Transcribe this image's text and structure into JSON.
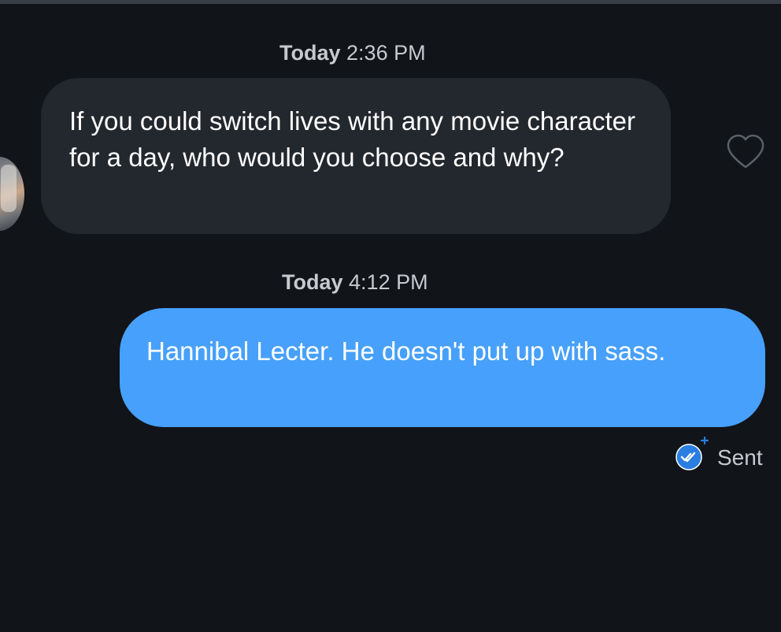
{
  "conversation": {
    "messages": [
      {
        "timestamp_day": "Today",
        "timestamp_time": "2:36 PM",
        "text": "If you could switch lives with any movie character for a day, who would you choose and why?"
      },
      {
        "timestamp_day": "Today",
        "timestamp_time": "4:12 PM",
        "text": "Hannibal Lecter. He doesn't put up with sass."
      }
    ],
    "status": "Sent"
  },
  "icons": {
    "like": "heart-outline-icon",
    "delivery": "double-check-icon"
  },
  "colors": {
    "background": "#111419",
    "received_bubble": "#23272e",
    "sent_bubble": "#47a0fb",
    "status_accent": "#2a7de1",
    "muted_text": "#c6cacf"
  }
}
